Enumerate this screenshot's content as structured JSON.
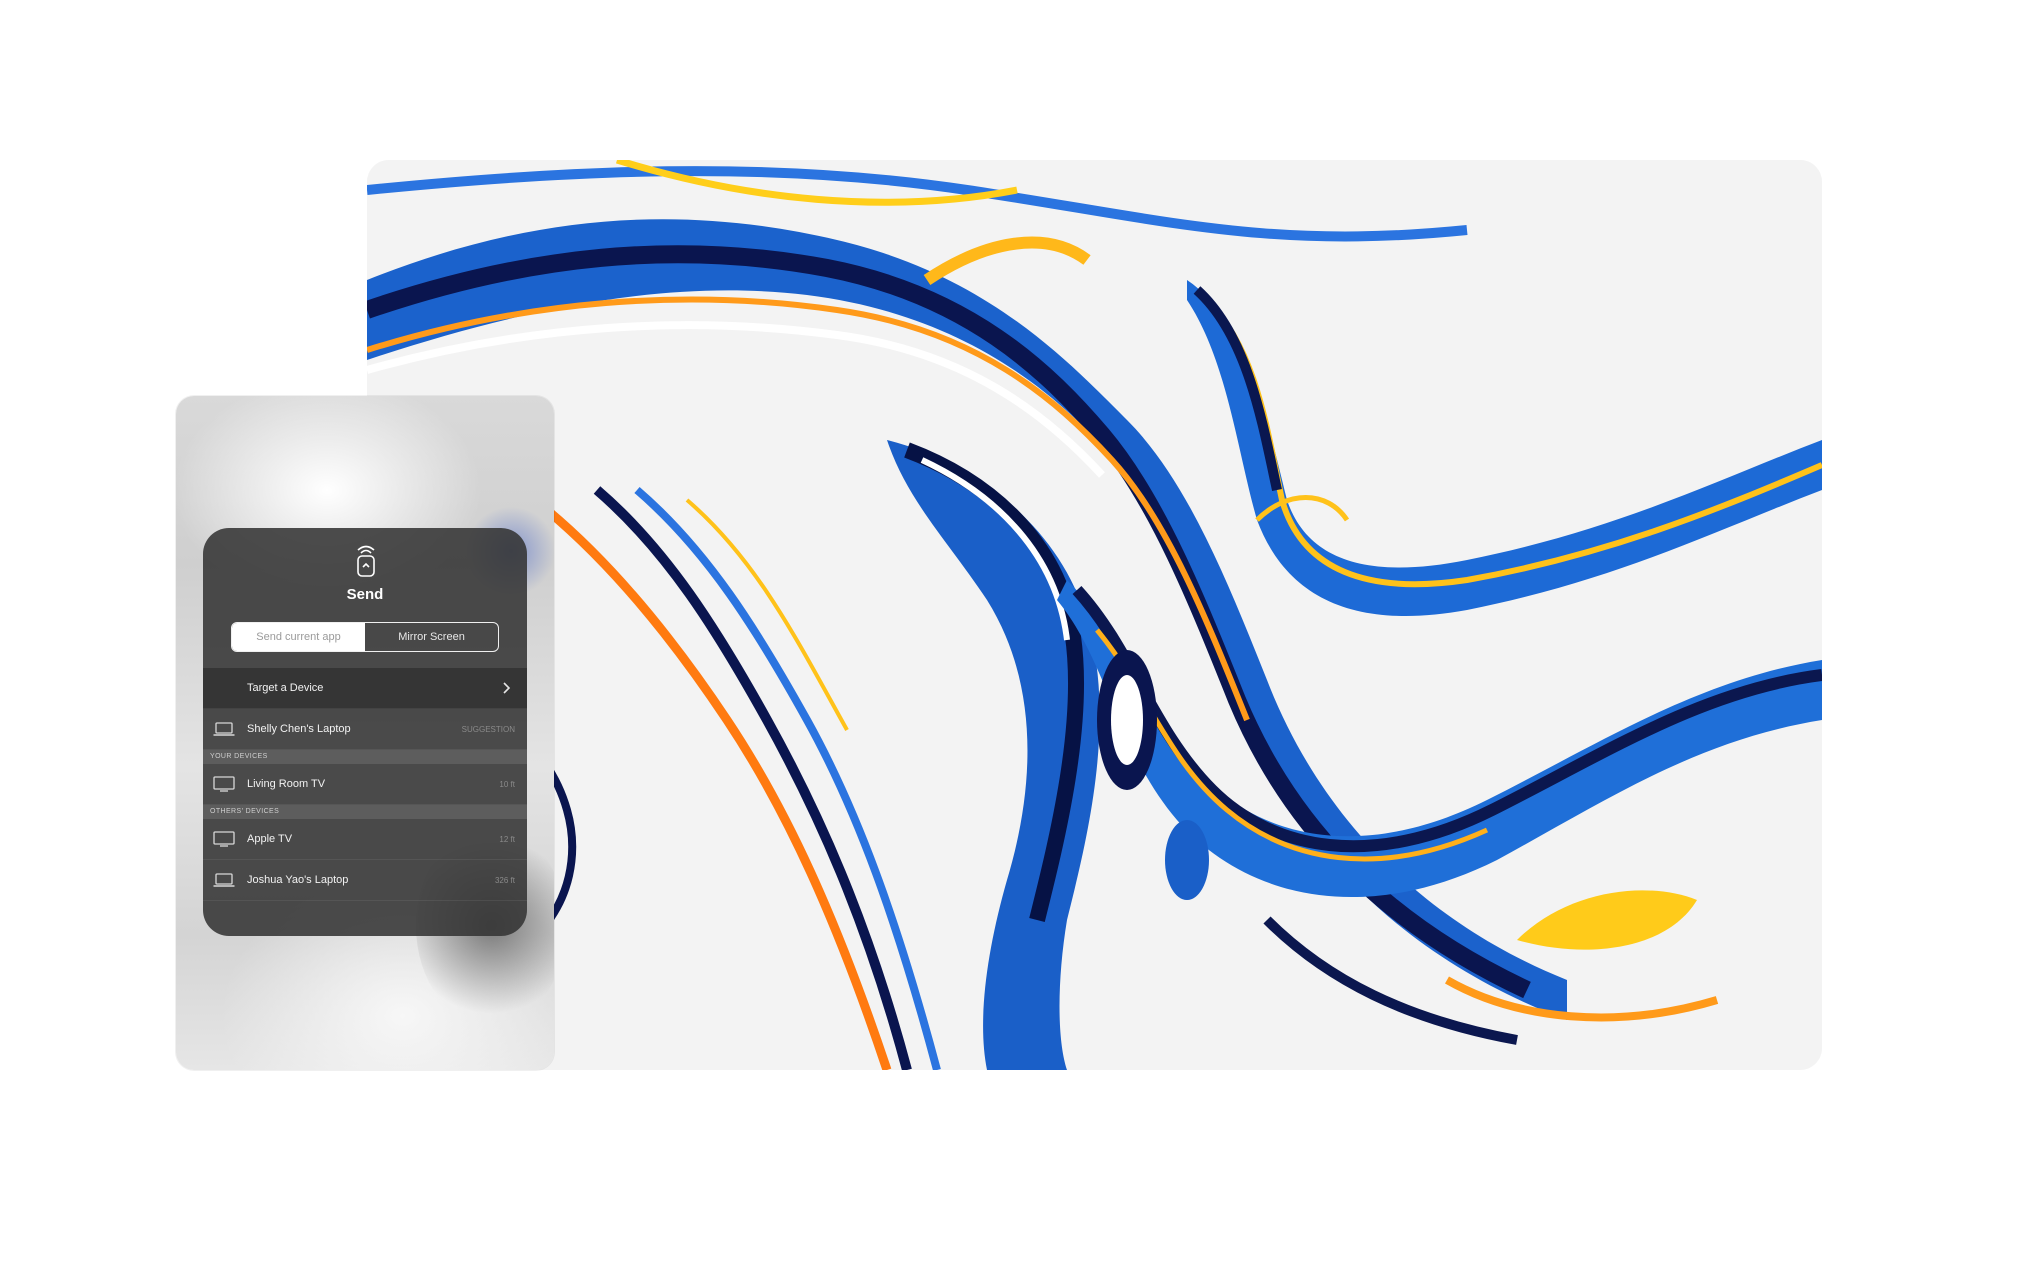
{
  "wallpaper": {
    "description": "abstract marbled swirls",
    "colors": {
      "blue": "#1e6fd9",
      "navy": "#0b1a5e",
      "orange": "#ff8c00",
      "yellow": "#ffd21a",
      "white": "#ffffff"
    }
  },
  "send_panel": {
    "icon": "remote-wireless-icon",
    "title": "Send",
    "modes": [
      {
        "label": "Send current app",
        "selected": true
      },
      {
        "label": "Mirror Screen",
        "selected": false
      }
    ],
    "target": {
      "label": "Target a Device",
      "icon": "chevron-right-icon"
    },
    "suggestion": {
      "name": "Shelly Chen's Laptop",
      "meta": "SUGGESTION",
      "icon": "laptop-icon"
    },
    "your_devices_header": "YOUR DEVICES",
    "your_devices": [
      {
        "name": "Living Room TV",
        "distance": "10 ft",
        "icon": "tv-icon"
      }
    ],
    "others_devices_header": "OTHERS' DEVICES",
    "others_devices": [
      {
        "name": "Apple TV",
        "distance": "12 ft",
        "icon": "tv-icon"
      },
      {
        "name": "Joshua Yao's Laptop",
        "distance": "326 ft",
        "icon": "laptop-icon"
      }
    ]
  }
}
